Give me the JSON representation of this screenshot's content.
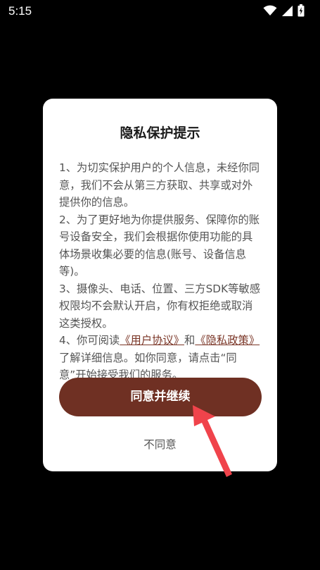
{
  "status_bar": {
    "time": "5:15"
  },
  "dialog": {
    "title": "隐私保护提示",
    "item1": "1、为切实保护用户的个人信息，未经你同意，我们不会从第三方获取、共享或对外提供你的信息。",
    "item2": "2、为了更好地为你提供服务、保障你的账号设备安全，我们会根据你使用功能的具体场景收集必要的信息(账号、设备信息等)。",
    "item3": "3、摄像头、电话、位置、三方SDK等敏感权限均不会默认开启，你有权拒绝或取消这类授权。",
    "item4_prefix": "4、你可阅读",
    "user_agreement_link": "《用户协议》",
    "item4_and": "和",
    "privacy_policy_link": "《隐私政策》",
    "item4_suffix": "了解详细信息。如你同意，请点击“同意”开始接受我们的服务。",
    "agree_label": "同意并继续",
    "disagree_label": "不同意"
  },
  "colors": {
    "dialog_bg": "#ffffff",
    "agree_button": "#6f3023",
    "link": "#7a3526",
    "arrow": "#f0434b"
  },
  "icons": {
    "wifi": "wifi-icon",
    "cellular": "cellular-signal-icon",
    "battery": "battery-charging-icon",
    "arrow": "pointer-arrow-icon"
  }
}
